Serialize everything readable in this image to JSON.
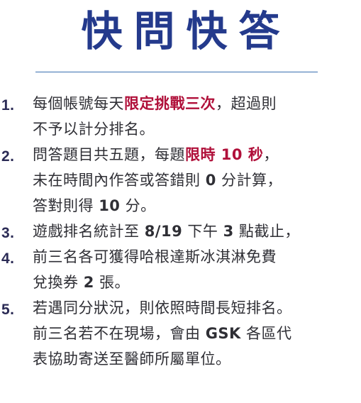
{
  "title": "快問快答",
  "rules": [
    {
      "number": "1.",
      "lines": [
        [
          {
            "text": "每個帳號每天",
            "style": "normal"
          },
          {
            "text": "限定挑戰三次",
            "style": "red"
          },
          {
            "text": "，超過則",
            "style": "normal"
          }
        ],
        [
          {
            "text": "不予以計分排名。",
            "style": "normal"
          }
        ]
      ]
    },
    {
      "number": "2.",
      "lines": [
        [
          {
            "text": "問答題目共五題，每題",
            "style": "normal"
          },
          {
            "text": "限時 10 秒",
            "style": "red"
          },
          {
            "text": "，",
            "style": "normal"
          }
        ],
        [
          {
            "text": "未在時間內作答或答錯則 ",
            "style": "normal"
          },
          {
            "text": "0",
            "style": "bold"
          },
          {
            "text": " 分計算，",
            "style": "normal"
          }
        ],
        [
          {
            "text": "答對則得 ",
            "style": "normal"
          },
          {
            "text": "10",
            "style": "bold"
          },
          {
            "text": " 分。",
            "style": "normal"
          }
        ]
      ]
    },
    {
      "number": "3.",
      "lines": [
        [
          {
            "text": "遊戲排名統計至 ",
            "style": "normal"
          },
          {
            "text": "8/19",
            "style": "bold"
          },
          {
            "text": " 下午 ",
            "style": "normal"
          },
          {
            "text": "3",
            "style": "bold"
          },
          {
            "text": " 點截止，",
            "style": "normal"
          }
        ]
      ]
    },
    {
      "number": "4.",
      "lines": [
        [
          {
            "text": "前三名各可獲得哈根達斯冰淇淋免費",
            "style": "normal"
          }
        ],
        [
          {
            "text": "兌換券 ",
            "style": "normal"
          },
          {
            "text": "2",
            "style": "bold"
          },
          {
            "text": " 張。",
            "style": "normal"
          }
        ]
      ]
    },
    {
      "number": "5.",
      "lines": [
        [
          {
            "text": "若遇同分狀況，則依照時間長短排名。",
            "style": "normal"
          }
        ],
        [
          {
            "text": "前三名若不在現場，會由 ",
            "style": "normal"
          },
          {
            "text": "GSK",
            "style": "bold"
          },
          {
            "text": " 各區代",
            "style": "normal"
          }
        ],
        [
          {
            "text": "表協助寄送至醫師所屬單位。",
            "style": "normal"
          }
        ]
      ]
    }
  ]
}
